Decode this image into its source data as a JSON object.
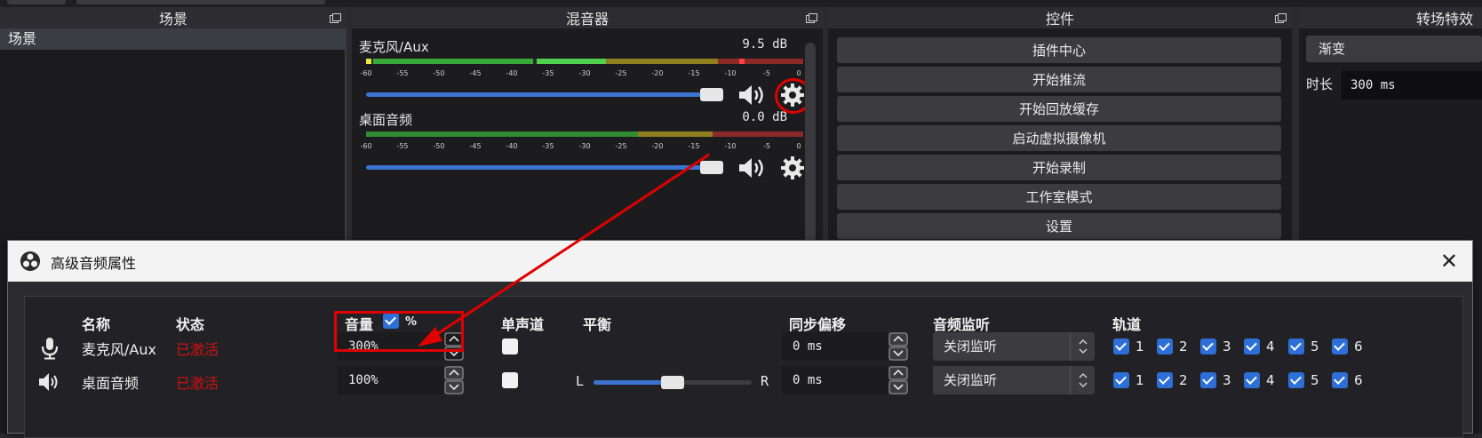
{
  "docks": {
    "scenes": {
      "title": "场景",
      "items": [
        "场景"
      ]
    },
    "mixer": {
      "title": "混音器",
      "scale_labels": [
        "-60",
        "-55",
        "-50",
        "-45",
        "-40",
        "-35",
        "-30",
        "-25",
        "-20",
        "-15",
        "-10",
        "-5",
        "0"
      ],
      "channels": [
        {
          "name": "麦克风/Aux",
          "db": "9.5 dB"
        },
        {
          "name": "桌面音频",
          "db": "0.0 dB"
        }
      ]
    },
    "controls": {
      "title": "控件",
      "buttons": [
        "插件中心",
        "开始推流",
        "开始回放缓存",
        "启动虚拟摄像机",
        "开始录制",
        "工作室模式",
        "设置"
      ]
    },
    "transitions": {
      "title": "转场特效",
      "selected": "渐变",
      "duration_label": "时长",
      "duration_value": "300 ms"
    }
  },
  "dialog": {
    "title": "高级音频属性",
    "close_glyph": "✕",
    "headers": {
      "name": "名称",
      "status": "状态",
      "volume": "音量",
      "volume_pct": "%",
      "mono": "单声道",
      "balance": "平衡",
      "sync_offset": "同步偏移",
      "monitoring": "音频监听",
      "tracks": "轨道"
    },
    "rows": [
      {
        "icon": "microphone-icon",
        "name": "麦克风/Aux",
        "status": "已激活",
        "volume": "300%",
        "mono": false,
        "sync_offset": "0 ms",
        "monitoring": "关闭监听",
        "tracks": [
          "1",
          "2",
          "3",
          "4",
          "5",
          "6"
        ]
      },
      {
        "icon": "speaker-icon",
        "name": "桌面音频",
        "status": "已激活",
        "volume": "100%",
        "mono": false,
        "balance_left": "L",
        "balance_right": "R",
        "balance_level": 0.5,
        "sync_offset": "0 ms",
        "monitoring": "关闭监听",
        "tracks": [
          "1",
          "2",
          "3",
          "4",
          "5",
          "6"
        ]
      }
    ]
  },
  "colors": {
    "accent": "#2d6fd6",
    "annotation": "#e00000",
    "status_active": "#d01010",
    "meter_green": "#4fd14f",
    "meter_yellow": "#c9b12a",
    "meter_red": "#d23b3b"
  }
}
